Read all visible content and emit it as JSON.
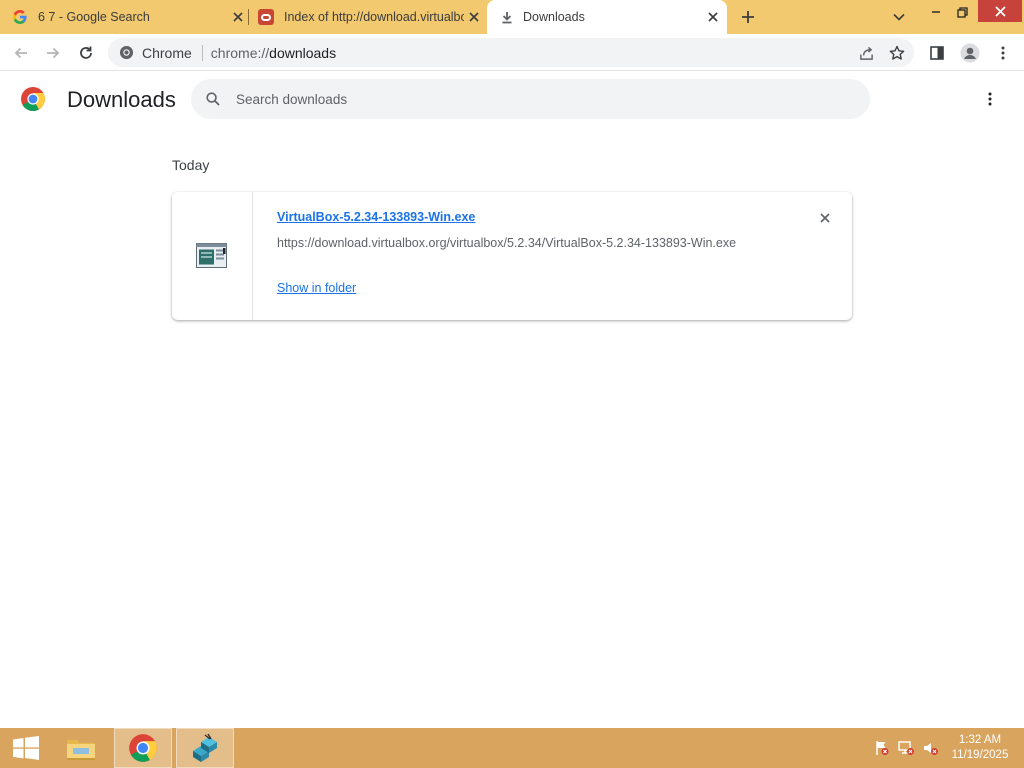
{
  "tabs": [
    {
      "title": "6 7 - Google Search",
      "icon": "google-g-icon"
    },
    {
      "title": "Index of http://download.virtualbox.org",
      "icon": "oracle-icon"
    },
    {
      "title": "Downloads",
      "icon": "download-icon",
      "active": true
    }
  ],
  "omnibox": {
    "chip_label": "Chrome",
    "url_scheme": "chrome://",
    "url_host": "downloads"
  },
  "page": {
    "title": "Downloads",
    "search_placeholder": "Search downloads"
  },
  "downloads": {
    "section_date": "Today",
    "items": [
      {
        "file_name": "VirtualBox-5.2.34-133893-Win.exe",
        "url": "https://download.virtualbox.org/virtualbox/5.2.34/VirtualBox-5.2.34-133893-Win.exe",
        "action_label": "Show in folder"
      }
    ]
  },
  "taskbar": {
    "time": "1:32 AM",
    "date": "11/19/2025"
  },
  "colors": {
    "tabstrip": "#f2c96e",
    "taskbar": "#d9a45d",
    "link": "#1a73e8"
  }
}
